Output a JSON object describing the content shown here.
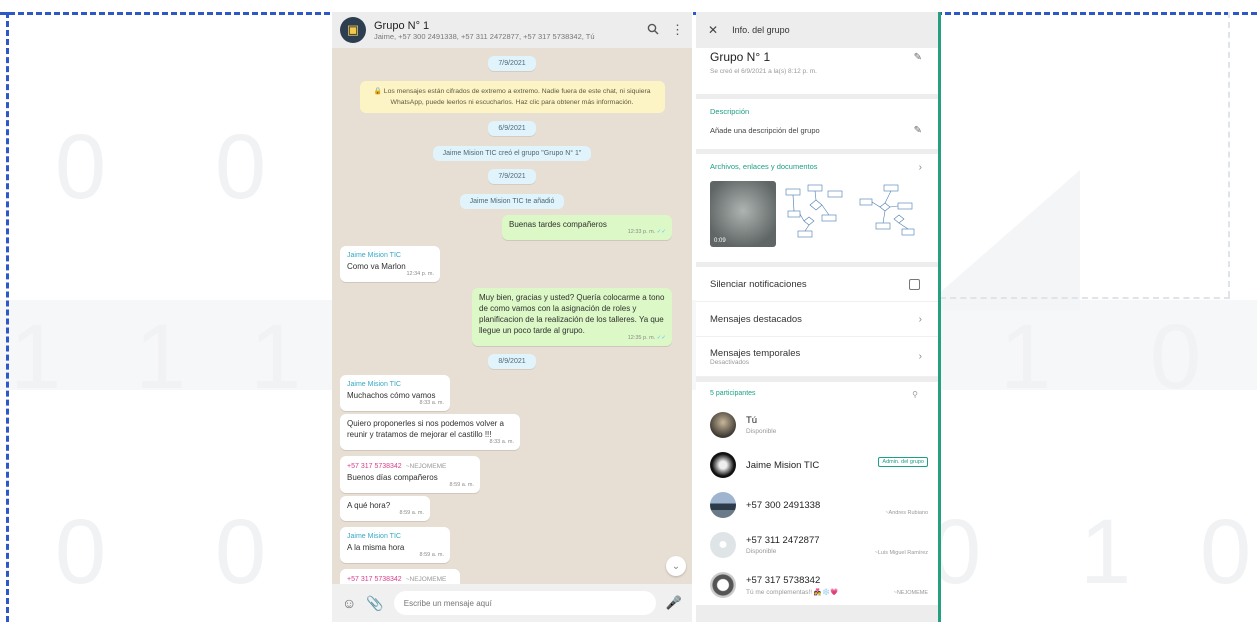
{
  "background": {
    "digits": [
      "0",
      "0",
      "1",
      "1",
      "1",
      "0",
      "0",
      "1",
      "0",
      "0",
      "1",
      "0"
    ]
  },
  "chat": {
    "group_name": "Grupo N° 1",
    "members_line": "Jaime, +57 300 2491338, +57 311 2472877, +57 317 5738342, Tú",
    "messages": {
      "date1": "7/9/2021",
      "encryption_notice": "🔒 Los mensajes están cifrados de extremo a extremo. Nadie fuera de este chat, ni siquiera WhatsApp, puede leerlos ni escucharlos. Haz clic para obtener más información.",
      "date2": "6/9/2021",
      "sys1": "Jaime Mision TIC creó el grupo \"Grupo N° 1\"",
      "date3": "7/9/2021",
      "sys2": "Jaime Mision TIC te añadió",
      "out1_text": "Buenas tardes compañeros",
      "out1_time": "12:33 p. m.",
      "in1_sender": "Jaime Mision TIC",
      "in1_text": "Como va Marlon",
      "in1_time": "12:34 p. m.",
      "out2_text": "Muy bien, gracias y usted? Quería colocarme a tono de como vamos con la asignación de roles y planificacion de la realización de los talleres. Ya que llegue un poco tarde al grupo.",
      "out2_time": "12:35 p. m.",
      "date4": "8/9/2021",
      "in2_sender": "Jaime Mision TIC",
      "in2_text": "Muchachos cómo vamos",
      "in2_time": "8:33 a. m.",
      "in3_text": "Quiero proponerles si nos podemos volver a reunir y tratamos de mejorar el castillo !!!",
      "in3_time": "8:33 a. m.",
      "in4_sender": "+57 317 5738342",
      "in4_nick": "~NEJOMEME",
      "in4_text": "Buenos días compañeros",
      "in4_time": "8:59 a. m.",
      "in5_text": "A qué hora?",
      "in5_time": "8:59 a. m.",
      "in6_sender": "Jaime Mision TIC",
      "in6_text": "A la misma hora",
      "in6_time": "8:59 a. m.",
      "in7_sender": "+57 317 5738342",
      "in7_nick": "~NEJOMEME"
    },
    "composer_placeholder": "Escribe un mensaje aquí"
  },
  "info": {
    "header_title": "Info. del grupo",
    "group_name": "Grupo N° 1",
    "created": "Se creó el 6/9/2021 a la(s) 8:12 p. m.",
    "description_label": "Descripción",
    "description_placeholder": "Añade una descripción del grupo",
    "files_label": "Archivos, enlaces y documentos",
    "video_duration": "0:09",
    "mute_label": "Silenciar notificaciones",
    "starred_label": "Mensajes destacados",
    "temporal_label": "Mensajes temporales",
    "temporal_state": "Desactivados",
    "participants_label": "5 participantes",
    "participants": [
      {
        "name": "Tú",
        "status": "Disponible",
        "badge": "",
        "alias": ""
      },
      {
        "name": "Jaime Mision TIC",
        "status": "",
        "badge": "Admin. del grupo",
        "alias": ""
      },
      {
        "name": "+57 300 2491338",
        "status": "",
        "badge": "",
        "alias": "~Andres Rubiano"
      },
      {
        "name": "+57 311 2472877",
        "status": "Disponible",
        "badge": "",
        "alias": "~Luis Miguel Ramírez"
      },
      {
        "name": "+57 317 5738342",
        "status": "Tú me complementas!! 👩‍❤️‍👨❄️💗",
        "badge": "",
        "alias": "~NEJOMEME"
      }
    ]
  }
}
